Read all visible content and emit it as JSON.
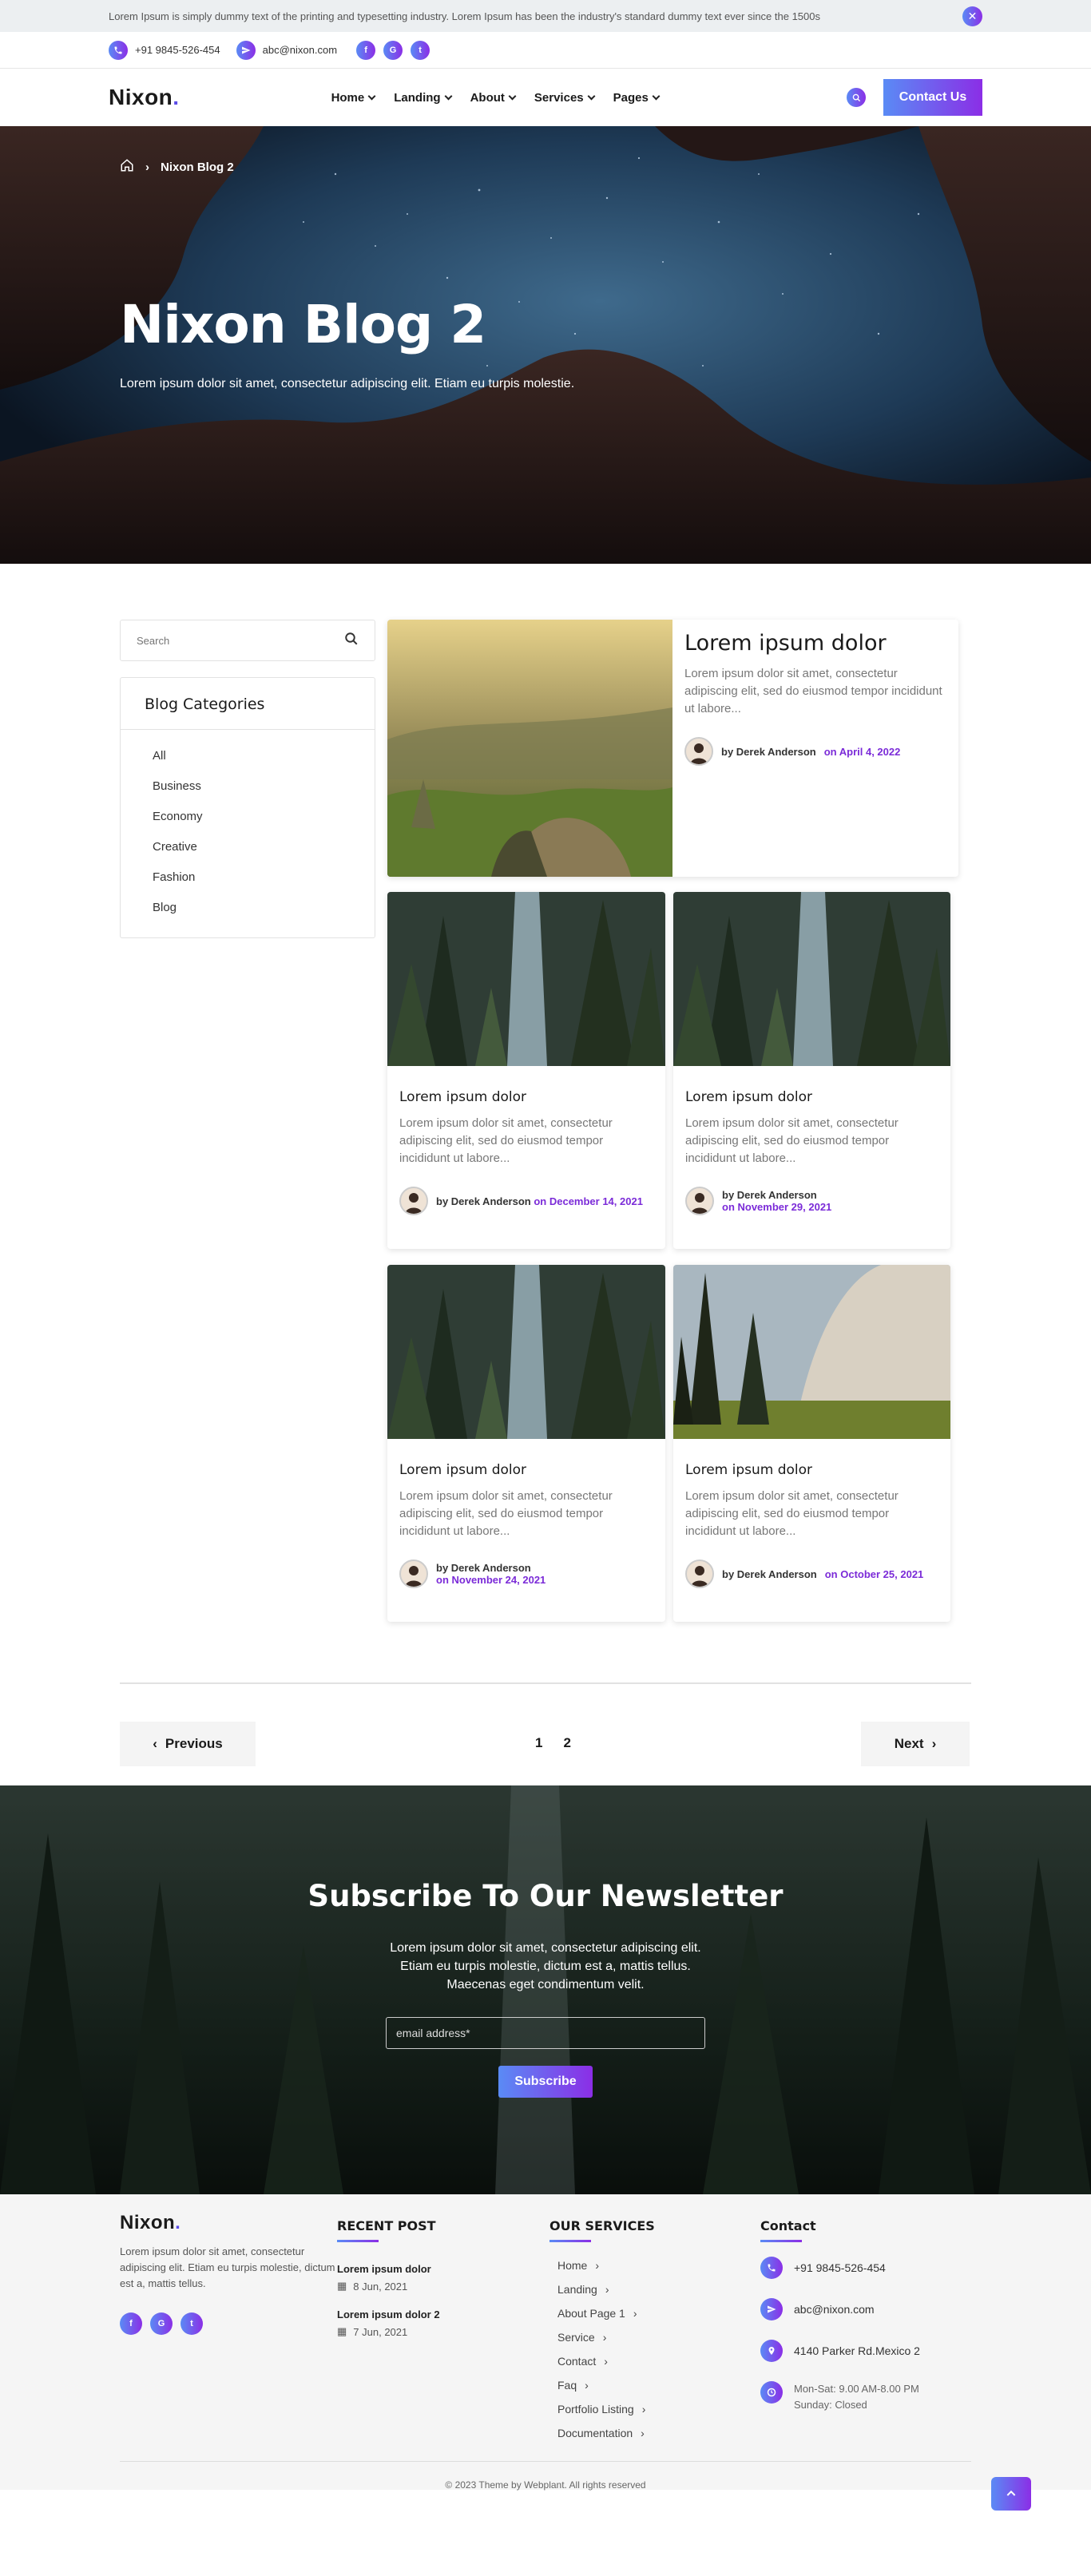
{
  "topbar": {
    "message": "Lorem Ipsum is simply dummy text of the printing and typesetting industry. Lorem Ipsum has been the industry's standard dummy text ever since the 1500s"
  },
  "contact": {
    "phone": "+91 9845-526-454",
    "email": "abc@nixon.com",
    "social": [
      "f",
      "G",
      "t"
    ]
  },
  "brand": {
    "name": "Nixon",
    "dot": ".",
    "accent": "#5b4de6",
    "gradient_start": "#5a8bf5",
    "gradient_end": "#8b2ee6"
  },
  "nav": {
    "items": [
      "Home",
      "Landing",
      "About",
      "Services",
      "Pages"
    ],
    "cta": "Contact Us"
  },
  "hero": {
    "breadcrumb": "Nixon Blog 2",
    "title": "Nixon Blog 2",
    "subtitle": "Lorem ipsum dolor sit amet, consectetur adipiscing elit. Etiam eu turpis molestie."
  },
  "sidebar": {
    "search_placeholder": "Search",
    "categories_title": "Blog Categories",
    "categories": [
      "All",
      "Business",
      "Economy",
      "Creative",
      "Fashion",
      "Blog"
    ]
  },
  "featured": {
    "title": "Lorem ipsum dolor",
    "excerpt": "Lorem ipsum dolor sit amet, consectetur adipiscing elit, sed do eiusmod tempor incididunt ut labore...",
    "author": "by Derek Anderson",
    "date": "on April 4, 2022"
  },
  "posts": [
    {
      "title": "Lorem ipsum dolor",
      "excerpt": "Lorem ipsum dolor sit amet, consectetur adipiscing elit, sed do eiusmod tempor incididunt ut labore...",
      "author": "by Derek Anderson",
      "date": "on December 14, 2021"
    },
    {
      "title": "Lorem ipsum dolor",
      "excerpt": "Lorem ipsum dolor sit amet, consectetur adipiscing elit, sed do eiusmod tempor incididunt ut labore...",
      "author": "by Derek Anderson",
      "date": "on November 29, 2021"
    },
    {
      "title": "Lorem ipsum dolor",
      "excerpt": "Lorem ipsum dolor sit amet, consectetur adipiscing elit, sed do eiusmod tempor incididunt ut labore...",
      "author": "by Derek Anderson",
      "date": "on November 24, 2021"
    },
    {
      "title": "Lorem ipsum dolor",
      "excerpt": "Lorem ipsum dolor sit amet, consectetur adipiscing elit, sed do eiusmod tempor incididunt ut labore...",
      "author": "by Derek Anderson",
      "date": "on October 25, 2021"
    }
  ],
  "pagination": {
    "previous": "Previous",
    "next": "Next",
    "pages": [
      "1",
      "2"
    ]
  },
  "newsletter": {
    "title": "Subscribe To Our Newsletter",
    "text": "Lorem ipsum dolor sit amet, consectetur adipiscing elit. Etiam eu turpis molestie, dictum est a, mattis tellus. Maecenas eget condimentum velit.",
    "placeholder": "email address*",
    "button": "Subscribe"
  },
  "footer": {
    "about": "Lorem ipsum dolor sit amet, consectetur adipiscing elit. Etiam eu turpis molestie, dictum est a, mattis tellus.",
    "recent_title": "RECENT POST",
    "recent": [
      {
        "title": "Lorem ipsum dolor",
        "date": "8 Jun, 2021"
      },
      {
        "title": "Lorem ipsum dolor 2",
        "date": "7 Jun, 2021"
      }
    ],
    "services_title": "OUR SERVICES",
    "services": [
      "Home",
      "Landing",
      "About Page 1",
      "Service",
      "Contact",
      "Faq",
      "Portfolio Listing",
      "Documentation"
    ],
    "contact_title": "Contact",
    "phone": "+91 9845-526-454",
    "email": "abc@nixon.com",
    "address": "4140 Parker Rd.Mexico 2",
    "hours": "Mon-Sat: 9.00 AM-8.00 PM Sunday: Closed",
    "copyright": "© 2023 Theme by Webplant. All rights reserved"
  }
}
